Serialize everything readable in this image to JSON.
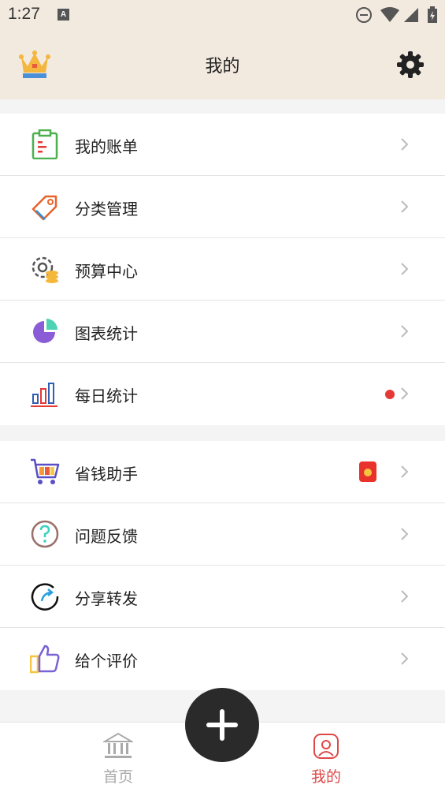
{
  "status_bar": {
    "time": "1:27",
    "notification_icon": "A"
  },
  "header": {
    "title": "我的",
    "left_icon": "crown-icon",
    "right_icon": "gear-icon"
  },
  "menu_group_1": [
    {
      "label": "我的账单",
      "icon": "clipboard-icon"
    },
    {
      "label": "分类管理",
      "icon": "tag-icon"
    },
    {
      "label": "预算中心",
      "icon": "budget-gear-coins-icon"
    },
    {
      "label": "图表统计",
      "icon": "pie-chart-icon"
    },
    {
      "label": "每日统计",
      "icon": "bar-chart-icon",
      "badge": "red-dot"
    }
  ],
  "menu_group_2": [
    {
      "label": "省钱助手",
      "icon": "shopping-cart-icon",
      "badge": "red-packet"
    },
    {
      "label": "问题反馈",
      "icon": "question-icon"
    },
    {
      "label": "分享转发",
      "icon": "share-icon"
    },
    {
      "label": "给个评价",
      "icon": "thumbs-up-icon"
    }
  ],
  "bottom_nav": {
    "home_label": "首页",
    "mine_label": "我的",
    "add_button": "plus-icon"
  },
  "colors": {
    "header_bg": "#f2e9df",
    "active": "#e04848",
    "inactive": "#aaaaaa"
  }
}
